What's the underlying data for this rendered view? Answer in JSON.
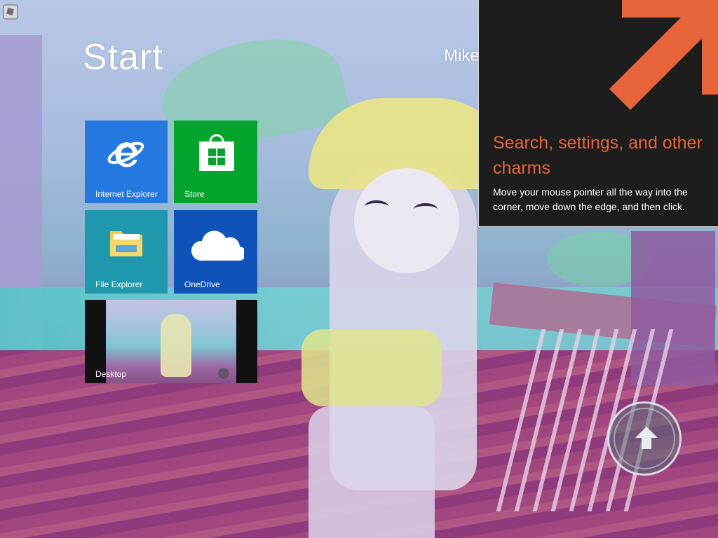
{
  "start": {
    "title": "Start",
    "user_name": "Mike"
  },
  "tiles": [
    {
      "id": "internet-explorer",
      "label": "Internet Explorer",
      "icon": "internet-explorer-icon",
      "color": "#2478e0"
    },
    {
      "id": "store",
      "label": "Store",
      "icon": "store-bag-icon",
      "color": "#05a42d"
    },
    {
      "id": "file-explorer",
      "label": "File Explorer",
      "icon": "folder-icon",
      "color": "#1f98ad"
    },
    {
      "id": "onedrive",
      "label": "OneDrive",
      "icon": "cloud-icon",
      "color": "#0f53b8"
    },
    {
      "id": "desktop",
      "label": "Desktop",
      "icon": "desktop-thumbnail",
      "color": "#111111"
    }
  ],
  "charms_tip": {
    "title": "Search, settings, and other charms",
    "body": "Move your mouse pointer all the way into the corner, move down the edge, and then click.",
    "arrow_color": "#e8643a",
    "background": "#1d1d1d"
  },
  "floating_button": {
    "icon": "up-arrow-icon"
  }
}
